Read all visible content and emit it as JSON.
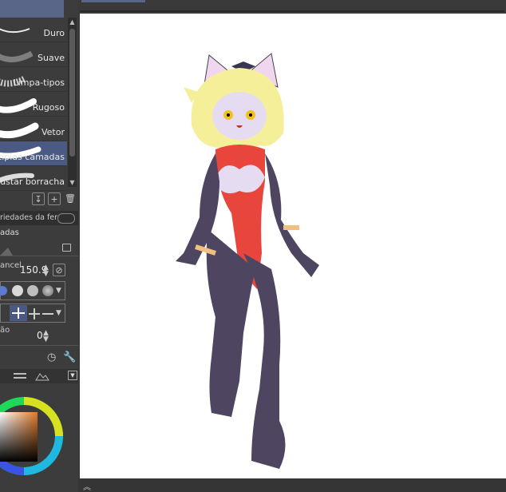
{
  "brushes": [
    {
      "label": "Duro",
      "selected": false
    },
    {
      "label": "Suave",
      "selected": false
    },
    {
      "label": "Limpa-tipos",
      "selected": false
    },
    {
      "label": "Rugoso",
      "selected": false
    },
    {
      "label": "Vetor",
      "selected": false
    },
    {
      "label": "Múltiplas camadas",
      "selected": true
    },
    {
      "label": "Ajustar borracha",
      "selected": false
    }
  ],
  "tool_property": {
    "header": "riedades da fer",
    "title": "adas",
    "size_label": "ancel",
    "size_value": "150.9",
    "opacity_label": "ão",
    "opacity_value": "0"
  },
  "colors": {
    "accent": "#4b5a82",
    "panel": "#3c3c3c",
    "canvas": "#ffffff"
  },
  "icons": [
    "export-icon",
    "add-icon",
    "trash-icon",
    "lock-icon",
    "clock-icon",
    "wrench-icon",
    "chevron-up-icon"
  ]
}
